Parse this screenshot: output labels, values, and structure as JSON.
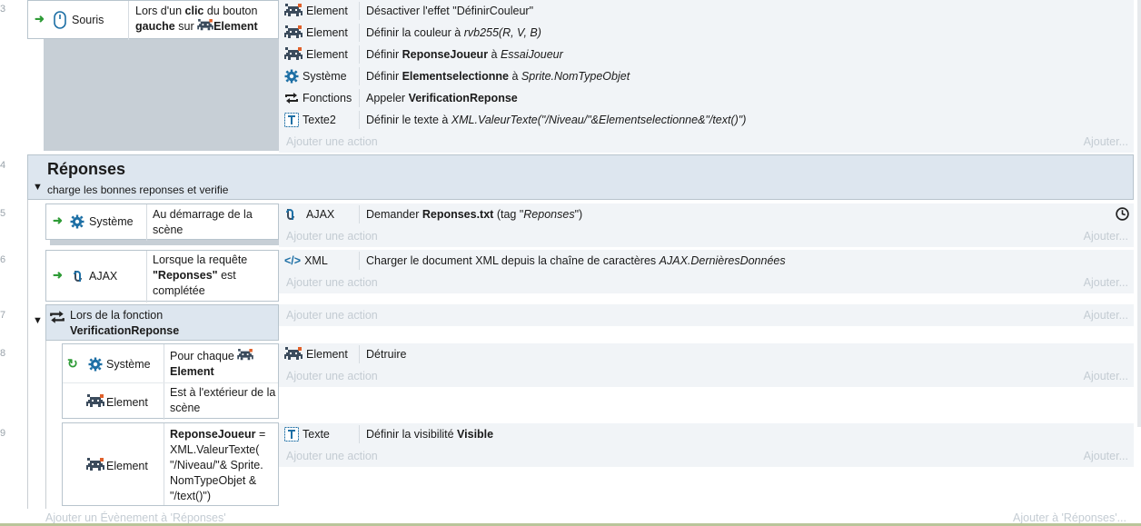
{
  "events": [
    {
      "line": "3",
      "conditions": [
        {
          "icon": "mouse-icon",
          "object": "Souris",
          "text_parts": [
            "Lors d'un ",
            "clic",
            " du bouton ",
            "gauche",
            " sur ",
            "Element"
          ]
        }
      ],
      "actions": [
        {
          "icon": "space-invader-icon",
          "object": "Element",
          "text": "Désactiver l'effet \"DéfinirCouleur\""
        },
        {
          "icon": "space-invader-icon",
          "object": "Element",
          "text_parts": [
            "Définir la couleur à ",
            "rvb255(R, V, B)"
          ]
        },
        {
          "icon": "space-invader-icon",
          "object": "Element",
          "text_parts": [
            "Définir ",
            "ReponseJoueur",
            " à ",
            "EssaiJoueur"
          ]
        },
        {
          "icon": "gear-icon",
          "object": "Système",
          "text_parts": [
            "Définir ",
            "Elementselectionne",
            " à ",
            "Sprite.NomTypeObjet"
          ]
        },
        {
          "icon": "function-arrows-icon",
          "object": "Fonctions",
          "text_parts": [
            "Appeler ",
            "VerificationReponse"
          ]
        },
        {
          "icon": "text-object-icon",
          "object": "Texte2",
          "text_parts": [
            "Définir le texte à ",
            "XML.ValeurTexte(\"/Niveau/\"&Elementselectionne&\"/text()\")"
          ]
        }
      ],
      "add_action": "Ajouter une action",
      "add_right": "Ajouter..."
    }
  ],
  "group": {
    "line": "4",
    "title": "Réponses",
    "description": "charge les bonnes reponses et verifie"
  },
  "event5": {
    "line": "5",
    "condition": {
      "object": "Système",
      "text": "Au démarrage de la scène"
    },
    "action": {
      "object": "AJAX",
      "text_parts": [
        "Demander ",
        "Reponses.txt",
        " (tag \"",
        "Reponses",
        "\")"
      ]
    },
    "add_action": "Ajouter une action",
    "add_right": "Ajouter..."
  },
  "event6": {
    "line": "6",
    "condition": {
      "object": "AJAX",
      "text_parts": [
        "Lorsque la requête ",
        "\"Reponses\"",
        " est complétée"
      ]
    },
    "action": {
      "object": "XML",
      "text_parts": [
        "Charger le document XML depuis la chaîne de caractères ",
        "AJAX.DernièresDonnées"
      ]
    },
    "add_action": "Ajouter une action",
    "add_right": "Ajouter..."
  },
  "event7": {
    "line": "7",
    "title_parts": [
      "Lors de la fonction",
      "VerificationReponse"
    ],
    "add_action": "Ajouter une action",
    "add_right": "Ajouter..."
  },
  "event8": {
    "line": "8",
    "condition1": {
      "object": "Système",
      "text_parts": [
        "Pour chaque",
        "Element"
      ]
    },
    "condition2": {
      "object": "Element",
      "text": "Est à l'extérieur de la scène"
    },
    "action": {
      "object": "Element",
      "text": "Détruire"
    },
    "add_action": "Ajouter une action",
    "add_right": "Ajouter..."
  },
  "event9": {
    "line": "9",
    "condition": {
      "object": "Element",
      "text_parts": [
        "ReponseJoueur",
        " = XML.ValeurTexte( \"/Niveau/\"& Sprite. NomTypeObjet & \"/text()\")"
      ]
    },
    "action": {
      "object": "Texte",
      "text_parts": [
        "Définir la visibilité ",
        "Visible"
      ]
    },
    "add_action": "Ajouter une action",
    "add_right": "Ajouter..."
  },
  "footer": {
    "add_event": "Ajouter un Évènement à 'Réponses'",
    "add_to": "Ajouter à 'Réponses'..."
  },
  "colors": {
    "accent_green": "#2e9b36",
    "group_bg": "#dde6ef",
    "condition_gray": "#c7cfd6",
    "action_bg": "#f1f4f7"
  }
}
